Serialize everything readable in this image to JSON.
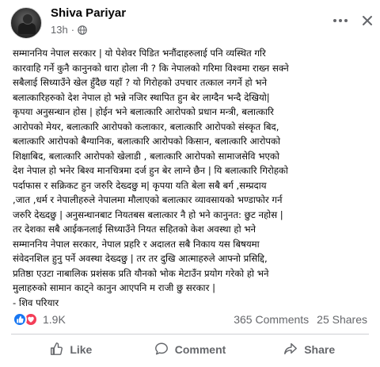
{
  "post": {
    "author": "Shiva Pariyar",
    "time": "13h",
    "separator": "·",
    "lines": [
      "सम्माननिय नेपाल सरकार | यो पेशेवर पिडित भनौंदाहरुलाई पनि व्यस्थित गरि",
      "कारवाहि गर्ने कुनै कानुनको धारा होला नी ? कि नेपालको गरिमा विश्वमा राख्न सक्ने",
      "सबैलाई सिध्याउँने खेल हुँदैछ यहाँ ? यो गिरोहको उपचार तत्काल नगर्ने हो भने",
      "बलात्कारिहरुको देश नेपाल हो भन्ने नजिर स्थापित हुन बेर लाग्दैन भन्दै  देखियो|",
      "कृपया अनुसन्धान होस  | होईन भने बलात्कारि आरोपको प्रधान मन्त्री, बलात्कारि",
      "आरोपको मेयर, बलात्कारि आरोपको कलाकार, बलात्कारि आरोपको संस्कृत बिद,",
      "बलात्कारि आरोपको बैग्यानिक, बलात्कारि आरोपको किसान, बलात्कारि आरोपको",
      "शिक्षाबिद, बलात्कारि आरोपको खेलाडी , बलात्कारि आरोपको सामाजसेवि भएको",
      "देश नेपाल हो भनेर बिश्व मानचित्रमा दर्ज हुन बेर लाग्ने छैन | यि बलात्कारि गिरोहको",
      "पर्दाफास र सक्रिकट हुन जरुरि  देख्दछु म| कृपया यति बेला सबै बर्ग ,सम्प्रदाय",
      ",जात ,धर्म र नेपालीहरुले नेपालमा मौलाएको बलात्कार व्यावसायको भण्डाफोर गर्न",
      "जरुरि देख्दछु | अनुसन्धानबाट नियतबस बलात्कार नै हो भने कानुनत: छुट नहोस |",
      "तर देशका सबै आईकनलाई सिध्याउँने नियत सहितको केश अवस्था हो भने",
      "सम्माननिय नेपाल सरकार, नेपाल प्रहरि र अदालत सबै निकाय यस बिषयमा",
      "संवेदनशिल हुनु पर्ने अवस्था देख्दछु | तर तर दुखि आत्माहरुले आफ्नो प्रसिद्दि,",
      "प्रतिष्ठा एउटा नाबालिक प्रशंसक प्रति यौनको भोक मेटाउँन प्रयोग गरेको हो भने",
      "मुलाहरुको सामान काट्ने कानुन आएपनि म राजी छु सरकार |",
      "-  शिव परियार"
    ]
  },
  "stats": {
    "reaction_count": "1.9K",
    "comments": "365 Comments",
    "shares": "25 Shares"
  },
  "actions": {
    "like": "Like",
    "comment": "Comment",
    "share": "Share"
  },
  "icons": {
    "globe": "globe-icon",
    "more": "more-horizontal-icon",
    "close": "close-icon",
    "like_reaction": "like-reaction-icon",
    "love_reaction": "love-reaction-icon"
  },
  "colors": {
    "like_blue": "#1877f2",
    "love_red": "#f33e58",
    "meta_gray": "#65676b"
  }
}
